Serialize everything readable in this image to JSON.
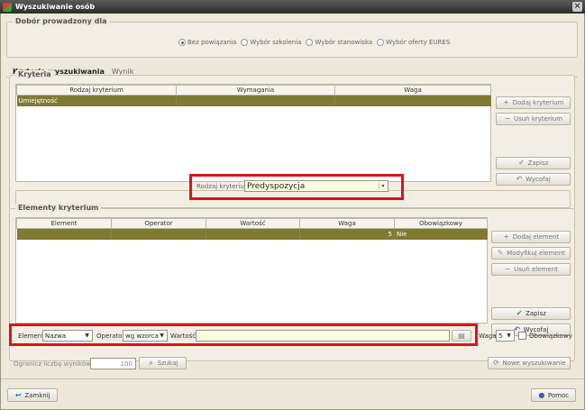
{
  "window": {
    "title": "Wyszukiwanie osób",
    "close_icon": "close-icon"
  },
  "dobor": {
    "legend": "Dobór prowadzony dla",
    "options": [
      "Bez powiązania",
      "Wybór szkolenia",
      "Wybór stanowiska",
      "Wybór oferty EURES"
    ],
    "selected": "Bez powiązania"
  },
  "tabs": [
    {
      "label": "Kryteria wyszukiwania",
      "active": true
    },
    {
      "label": "Wynik",
      "active": false
    }
  ],
  "kryteria": {
    "legend": "Kryteria",
    "columns": [
      "Rodzaj kryterium",
      "Wymagania",
      "Waga"
    ],
    "rows": [
      [
        "Umiejętność",
        "",
        ""
      ]
    ],
    "buttons": {
      "add": "Dodaj kryterium",
      "remove": "Usuń kryterium",
      "save": "Zapisz",
      "undo": "Wycofaj"
    },
    "type_label": "Rodzaj kryterium",
    "type_value": "Predyspozycja"
  },
  "elementy": {
    "legend": "Elementy kryterium",
    "columns": [
      "Element",
      "Operator",
      "Wartość",
      "Waga",
      "Obowiązkowy"
    ],
    "rows": [
      [
        "",
        "",
        "",
        "5",
        "Nie"
      ]
    ],
    "buttons": {
      "add": "Dodaj element",
      "modify": "Modyfikuj element",
      "remove": "Usuń element",
      "save": "Zapisz",
      "undo": "Wycofaj"
    },
    "editor": {
      "element_label": "Element",
      "element_value": "Nazwa",
      "operator_label": "Operator",
      "operator_value": "wg wzorca",
      "value_label": "Wartość",
      "value_value": "",
      "waga_label": "Waga",
      "waga_value": "5",
      "mandatory_label": "Obowiązkowy",
      "mandatory_checked": false
    }
  },
  "bottom": {
    "limit_label": "Ogranicz liczbę wyników do",
    "limit_value": "100",
    "search": "Szukaj",
    "new_search": "Nowe wyszukiwanie",
    "close": "Zamknij",
    "help": "Pomoc"
  },
  "colors": {
    "selection": "#7f7a32",
    "highlight_frame": "#d9141b",
    "window_bg": "#ede8da"
  }
}
